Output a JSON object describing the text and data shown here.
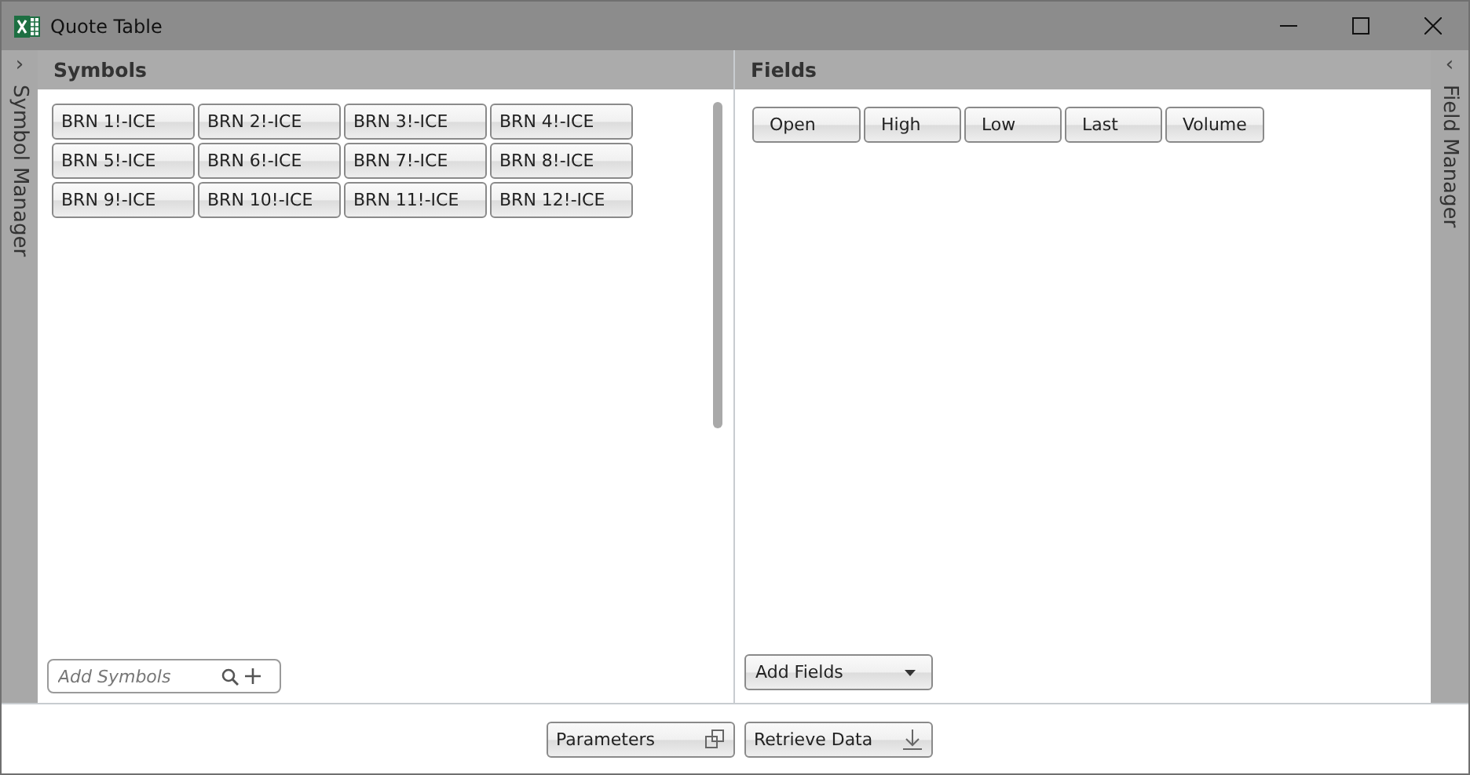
{
  "window": {
    "title": "Quote Table"
  },
  "left_strip": {
    "label": "Symbol Manager",
    "collapse": "›"
  },
  "right_strip": {
    "label": "Field Manager",
    "collapse": "‹"
  },
  "symbols": {
    "title": "Symbols",
    "items": [
      {
        "label": "BRN 1!-ICE"
      },
      {
        "label": "BRN 2!-ICE"
      },
      {
        "label": "BRN 3!-ICE"
      },
      {
        "label": "BRN 4!-ICE"
      },
      {
        "label": "BRN 5!-ICE"
      },
      {
        "label": "BRN 6!-ICE"
      },
      {
        "label": "BRN 7!-ICE"
      },
      {
        "label": "BRN 8!-ICE"
      },
      {
        "label": "BRN 9!-ICE"
      },
      {
        "label": "BRN 10!-ICE"
      },
      {
        "label": "BRN 11!-ICE"
      },
      {
        "label": "BRN 12!-ICE"
      }
    ],
    "search": {
      "placeholder": "Add Symbols"
    }
  },
  "fields": {
    "title": "Fields",
    "items": [
      {
        "label": "Open"
      },
      {
        "label": "High"
      },
      {
        "label": "Low"
      },
      {
        "label": "Last"
      },
      {
        "label": "Volume"
      }
    ],
    "add": {
      "label": "Add Fields"
    }
  },
  "buttons": [
    {
      "label": "Parameters",
      "kind": "windows"
    },
    {
      "label": "Retrieve Data",
      "kind": "download"
    }
  ]
}
